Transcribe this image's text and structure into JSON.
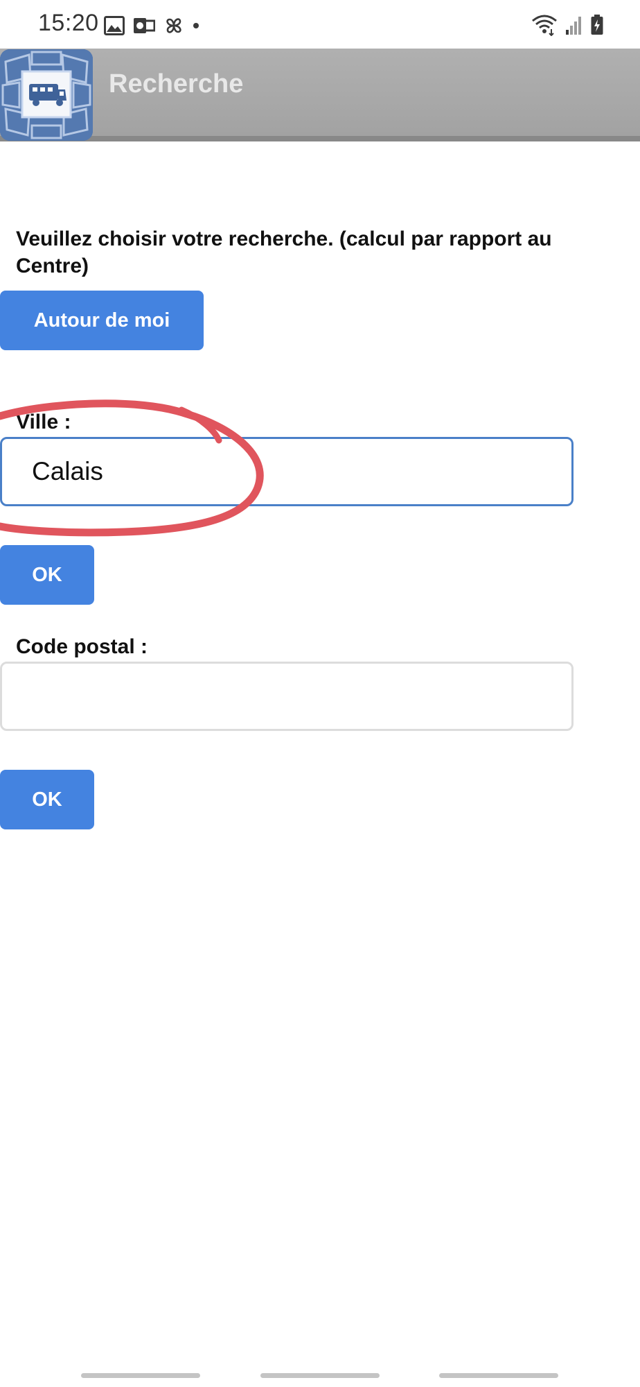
{
  "status_bar": {
    "time": "15:20",
    "left_icons": [
      "image-icon",
      "outlook-icon",
      "pinwheel-icon",
      "dot-icon"
    ],
    "right_icons": [
      "wifi-icon",
      "signal-icon",
      "battery-icon"
    ]
  },
  "app_bar": {
    "title": "Recherche",
    "logo_icon": "camper-van-icon"
  },
  "main": {
    "instruction": "Veuillez choisir votre recherche. (calcul par rapport au Centre)",
    "around_me_button": "Autour de moi",
    "city": {
      "label": "Ville :",
      "value": "Calais",
      "ok_button": "OK"
    },
    "postal": {
      "label": "Code postal :",
      "value": "",
      "ok_button": "OK"
    }
  },
  "colors": {
    "button_blue": "#4483e0",
    "active_input_border": "#4a80c8",
    "annotation_red": "#e0555d",
    "app_bar_gray": "#a8a8a8"
  }
}
